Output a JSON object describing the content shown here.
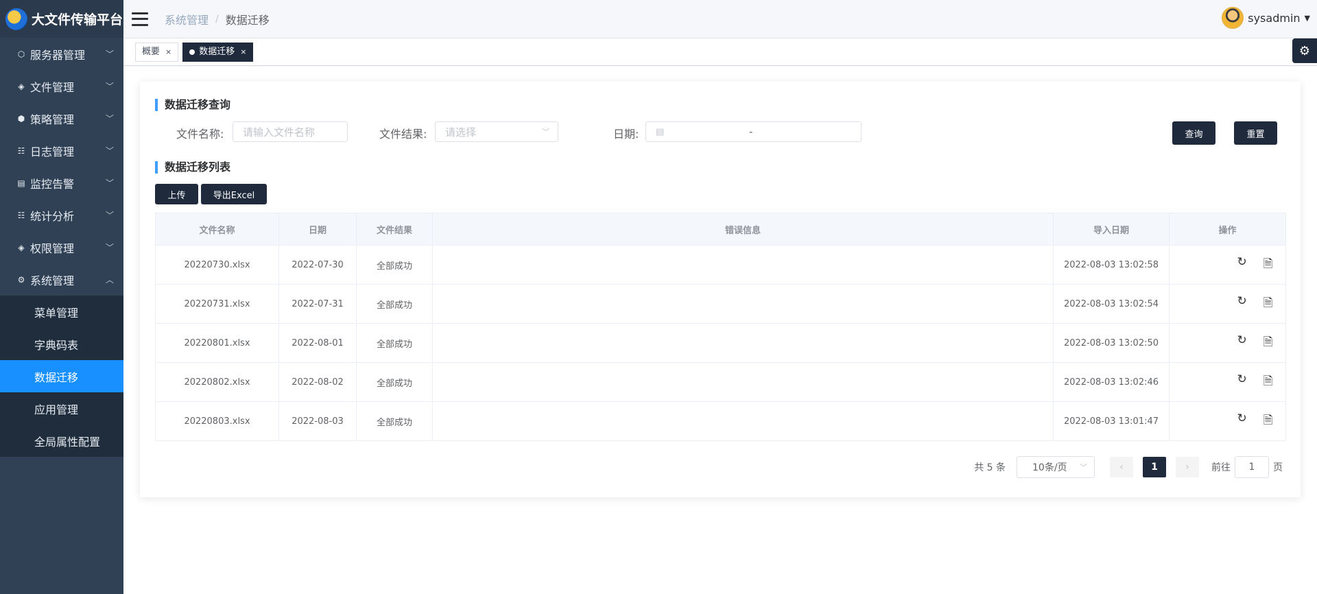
{
  "app": {
    "title": "大文件传输平台"
  },
  "sidebar": {
    "items": [
      {
        "label": "服务器管理",
        "icon": "server-icon"
      },
      {
        "label": "文件管理",
        "icon": "layers-icon"
      },
      {
        "label": "策略管理",
        "icon": "strategy-icon"
      },
      {
        "label": "日志管理",
        "icon": "list-icon"
      },
      {
        "label": "监控告警",
        "icon": "monitor-icon"
      },
      {
        "label": "统计分析",
        "icon": "chart-icon"
      },
      {
        "label": "权限管理",
        "icon": "shield-icon"
      },
      {
        "label": "系统管理",
        "icon": "gear-icon"
      }
    ],
    "sub_items": [
      "菜单管理",
      "字典码表",
      "数据迁移",
      "应用管理",
      "全局属性配置"
    ],
    "active_sub": "数据迁移"
  },
  "header": {
    "breadcrumb_parent": "系统管理",
    "breadcrumb_sep": "/",
    "breadcrumb_current": "数据迁移",
    "username": "sysadmin"
  },
  "tags": [
    {
      "label": "概要",
      "close": "×"
    },
    {
      "label": "数据迁移",
      "close": "×"
    }
  ],
  "query": {
    "title": "数据迁移查询",
    "filename_label": "文件名称:",
    "filename_placeholder": "请输入文件名称",
    "result_label": "文件结果:",
    "result_placeholder": "请选择",
    "date_label": "日期:",
    "date_sep": "-",
    "search_btn": "查询",
    "reset_btn": "重置"
  },
  "list": {
    "title": "数据迁移列表",
    "upload_btn": "上传",
    "export_btn": "导出Excel",
    "columns": [
      "文件名称",
      "日期",
      "文件结果",
      "错误信息",
      "导入日期",
      "操作"
    ],
    "rows": [
      [
        "20220730.xlsx",
        "2022-07-30",
        "全部成功",
        "",
        "2022-08-03 13:02:58"
      ],
      [
        "20220731.xlsx",
        "2022-07-31",
        "全部成功",
        "",
        "2022-08-03 13:02:54"
      ],
      [
        "20220801.xlsx",
        "2022-08-01",
        "全部成功",
        "",
        "2022-08-03 13:02:50"
      ],
      [
        "20220802.xlsx",
        "2022-08-02",
        "全部成功",
        "",
        "2022-08-03 13:02:46"
      ],
      [
        "20220803.xlsx",
        "2022-08-03",
        "全部成功",
        "",
        "2022-08-03 13:01:47"
      ]
    ]
  },
  "pagination": {
    "total": "共 5 条",
    "page_size": "10条/页",
    "current_page": "1",
    "goto_label": "前往",
    "goto_value": "1",
    "page_unit": "页"
  },
  "colors": {
    "accent": "#1890ff",
    "dark": "#1f2a3c",
    "sidebar": "#304156"
  }
}
